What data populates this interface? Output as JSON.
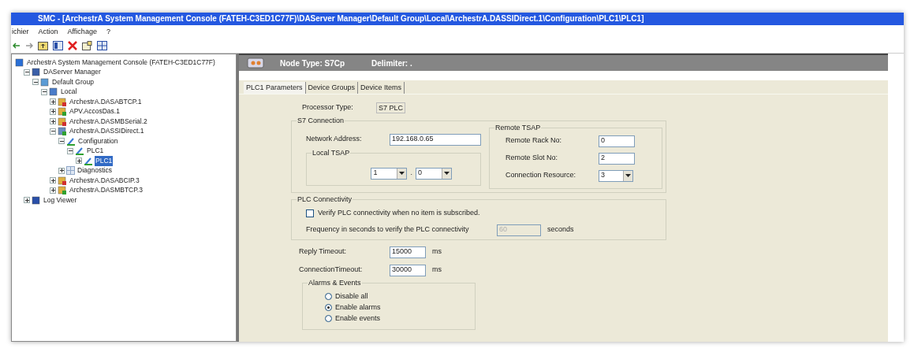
{
  "window": {
    "title": "SMC - [ArchestrA System Management Console (FATEH-C3ED1C77F)\\DAServer Manager\\Default Group\\Local\\ArchestrA.DASSIDirect.1\\Configuration\\PLC1\\PLC1]"
  },
  "menu": [
    {
      "label": "ichier"
    },
    {
      "label": "Action"
    },
    {
      "label": "Affichage"
    },
    {
      "label": "?"
    }
  ],
  "tree": [
    {
      "label": "ArchestrA System Management Console (FATEH-C3ED1C77F)",
      "kind": "console",
      "selected": false,
      "children": [
        {
          "label": "DAServer Manager",
          "kind": "manager",
          "expanded": true,
          "selected": false,
          "children": [
            {
              "label": "Default Group",
              "kind": "group",
              "expanded": true,
              "selected": false,
              "children": [
                {
                  "label": "Local",
                  "kind": "computer",
                  "expanded": true,
                  "selected": false,
                  "children": [
                    {
                      "label": "ArchestrA.DASABTCP.1",
                      "kind": "server-stopped",
                      "expanded": false,
                      "selected": false
                    },
                    {
                      "label": "APV.AccosDas.1",
                      "kind": "server-running",
                      "expanded": false,
                      "selected": false
                    },
                    {
                      "label": "ArchestrA.DASMBSerial.2",
                      "kind": "server-stopped",
                      "expanded": false,
                      "selected": false
                    },
                    {
                      "label": "ArchestrA.DASSIDirect.1",
                      "kind": "server-active",
                      "expanded": true,
                      "selected": false,
                      "children": [
                        {
                          "label": "Configuration",
                          "kind": "config",
                          "expanded": true,
                          "selected": false,
                          "children": [
                            {
                              "label": "PLC1",
                              "kind": "config",
                              "expanded": true,
                              "selected": false,
                              "children": [
                                {
                                  "label": "PLC1",
                                  "kind": "config",
                                  "expanded": false,
                                  "selected": true
                                }
                              ]
                            }
                          ]
                        },
                        {
                          "label": "Diagnostics",
                          "kind": "grid",
                          "expanded": false,
                          "selected": false
                        }
                      ]
                    },
                    {
                      "label": "ArchestrA.DASABCIP.3",
                      "kind": "server-stopped",
                      "expanded": false,
                      "selected": false
                    },
                    {
                      "label": "ArchestrA.DASMBTCP.3",
                      "kind": "server-running",
                      "expanded": false,
                      "selected": false
                    }
                  ]
                }
              ]
            }
          ]
        },
        {
          "label": "Log Viewer",
          "kind": "log",
          "expanded": false,
          "selected": false
        }
      ]
    }
  ],
  "header": {
    "node_type": "Node Type: S7Cp",
    "delimiter": "Delimiter: ."
  },
  "tabs": [
    {
      "label": "PLC1 Parameters",
      "selected": true
    },
    {
      "label": "Device Groups",
      "selected": false
    },
    {
      "label": "Device Items",
      "selected": false
    }
  ],
  "processor_type": {
    "label": "Processor Type:",
    "value": "S7 PLC"
  },
  "s7_connection": {
    "title": "S7 Connection",
    "network_address": {
      "label": "Network Address:",
      "value": "192.168.0.65"
    },
    "local_tsap": {
      "title": "Local TSAP",
      "rack": "1",
      "separator": ".",
      "slot": "0"
    },
    "remote_tsap": {
      "title": "Remote TSAP",
      "rack": {
        "label": "Remote Rack No:",
        "value": "0"
      },
      "slot": {
        "label": "Remote Slot No:",
        "value": "2"
      },
      "resource": {
        "label": "Connection Resource:",
        "value": "3"
      }
    }
  },
  "plc_connectivity": {
    "title": "PLC Connectivity",
    "verify": {
      "label": "Verify PLC connectivity when no item is subscribed.",
      "checked": false
    },
    "frequency": {
      "label": "Frequency in seconds to verify the PLC connectivity",
      "value": "60",
      "disabled": true,
      "unit": "seconds"
    }
  },
  "timeouts": [
    {
      "label": "Reply Timeout:",
      "value": "15000",
      "unit": "ms"
    },
    {
      "label": "ConnectionTimeout:",
      "value": "30000",
      "unit": "ms"
    }
  ],
  "alarms": {
    "title": "Alarms & Events",
    "options": [
      {
        "label": "Disable all",
        "selected": false
      },
      {
        "label": "Enable alarms",
        "selected": true
      },
      {
        "label": "Enable events",
        "selected": false
      }
    ]
  }
}
